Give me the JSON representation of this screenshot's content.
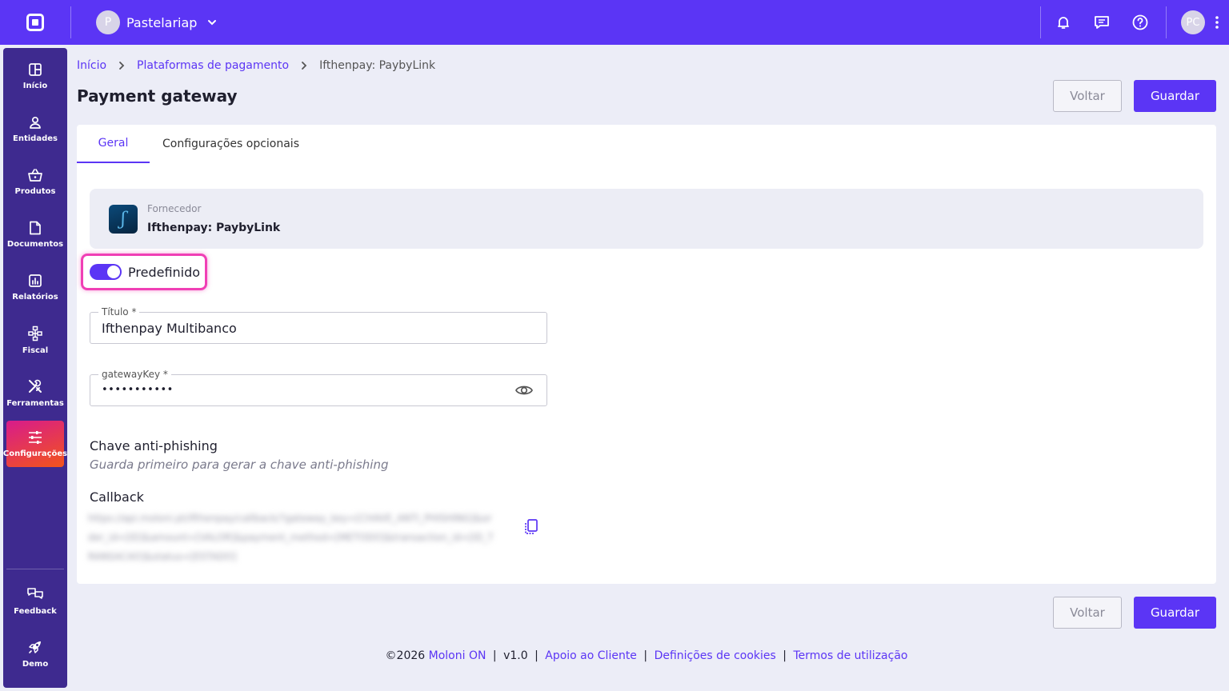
{
  "header": {
    "company_initial": "P",
    "company_name": "Pastelariap",
    "user_initials": "PC"
  },
  "sidebar": {
    "items": [
      {
        "label": "Início",
        "icon": "dashboard-icon"
      },
      {
        "label": "Entidades",
        "icon": "user-icon"
      },
      {
        "label": "Produtos",
        "icon": "basket-icon"
      },
      {
        "label": "Documentos",
        "icon": "document-icon"
      },
      {
        "label": "Relatórios",
        "icon": "report-icon"
      },
      {
        "label": "Fiscal",
        "icon": "fiscal-icon"
      },
      {
        "label": "Ferramentas",
        "icon": "tools-icon"
      },
      {
        "label": "Configurações",
        "icon": "settings-sliders-icon"
      }
    ],
    "bottom": [
      {
        "label": "Feedback",
        "icon": "feedback-icon"
      },
      {
        "label": "Demo",
        "icon": "rocket-icon"
      }
    ]
  },
  "breadcrumb": {
    "home": "Início",
    "parent": "Plataformas de pagamento",
    "current": "Ifthenpay: PaybyLink"
  },
  "page": {
    "title": "Payment gateway",
    "back_label": "Voltar",
    "save_label": "Guardar"
  },
  "tabs": [
    "Geral",
    "Configurações opcionais"
  ],
  "provider": {
    "label": "Fornecedor",
    "name": "Ifthenpay: PaybyLink"
  },
  "toggle": {
    "label": "Predefinido",
    "on": true
  },
  "form": {
    "title_label": "Título *",
    "title_value": "Ifthenpay Multibanco",
    "key_label": "gatewayKey *",
    "key_value": "•••••••••••",
    "antiphishing_title": "Chave anti-phishing",
    "antiphishing_hint": "Guarda primeiro para gerar a chave anti-phishing",
    "callback_title": "Callback",
    "callback_value": "https://api.moloni.pt/ifthenpay/callback/?gateway_key=[CHAVE_ANTI_PHISHING]&order_id=[ID]&amount=[VALOR]&payment_method=[METODO]&transaction_id=[ID_TRANSACAO]&status=[ESTADO]"
  },
  "footer": {
    "copyright": "©2026",
    "brand": "Moloni ON",
    "version": "v1.0",
    "support": "Apoio ao Cliente",
    "cookies": "Definições de cookies",
    "terms": "Termos de utilização"
  }
}
